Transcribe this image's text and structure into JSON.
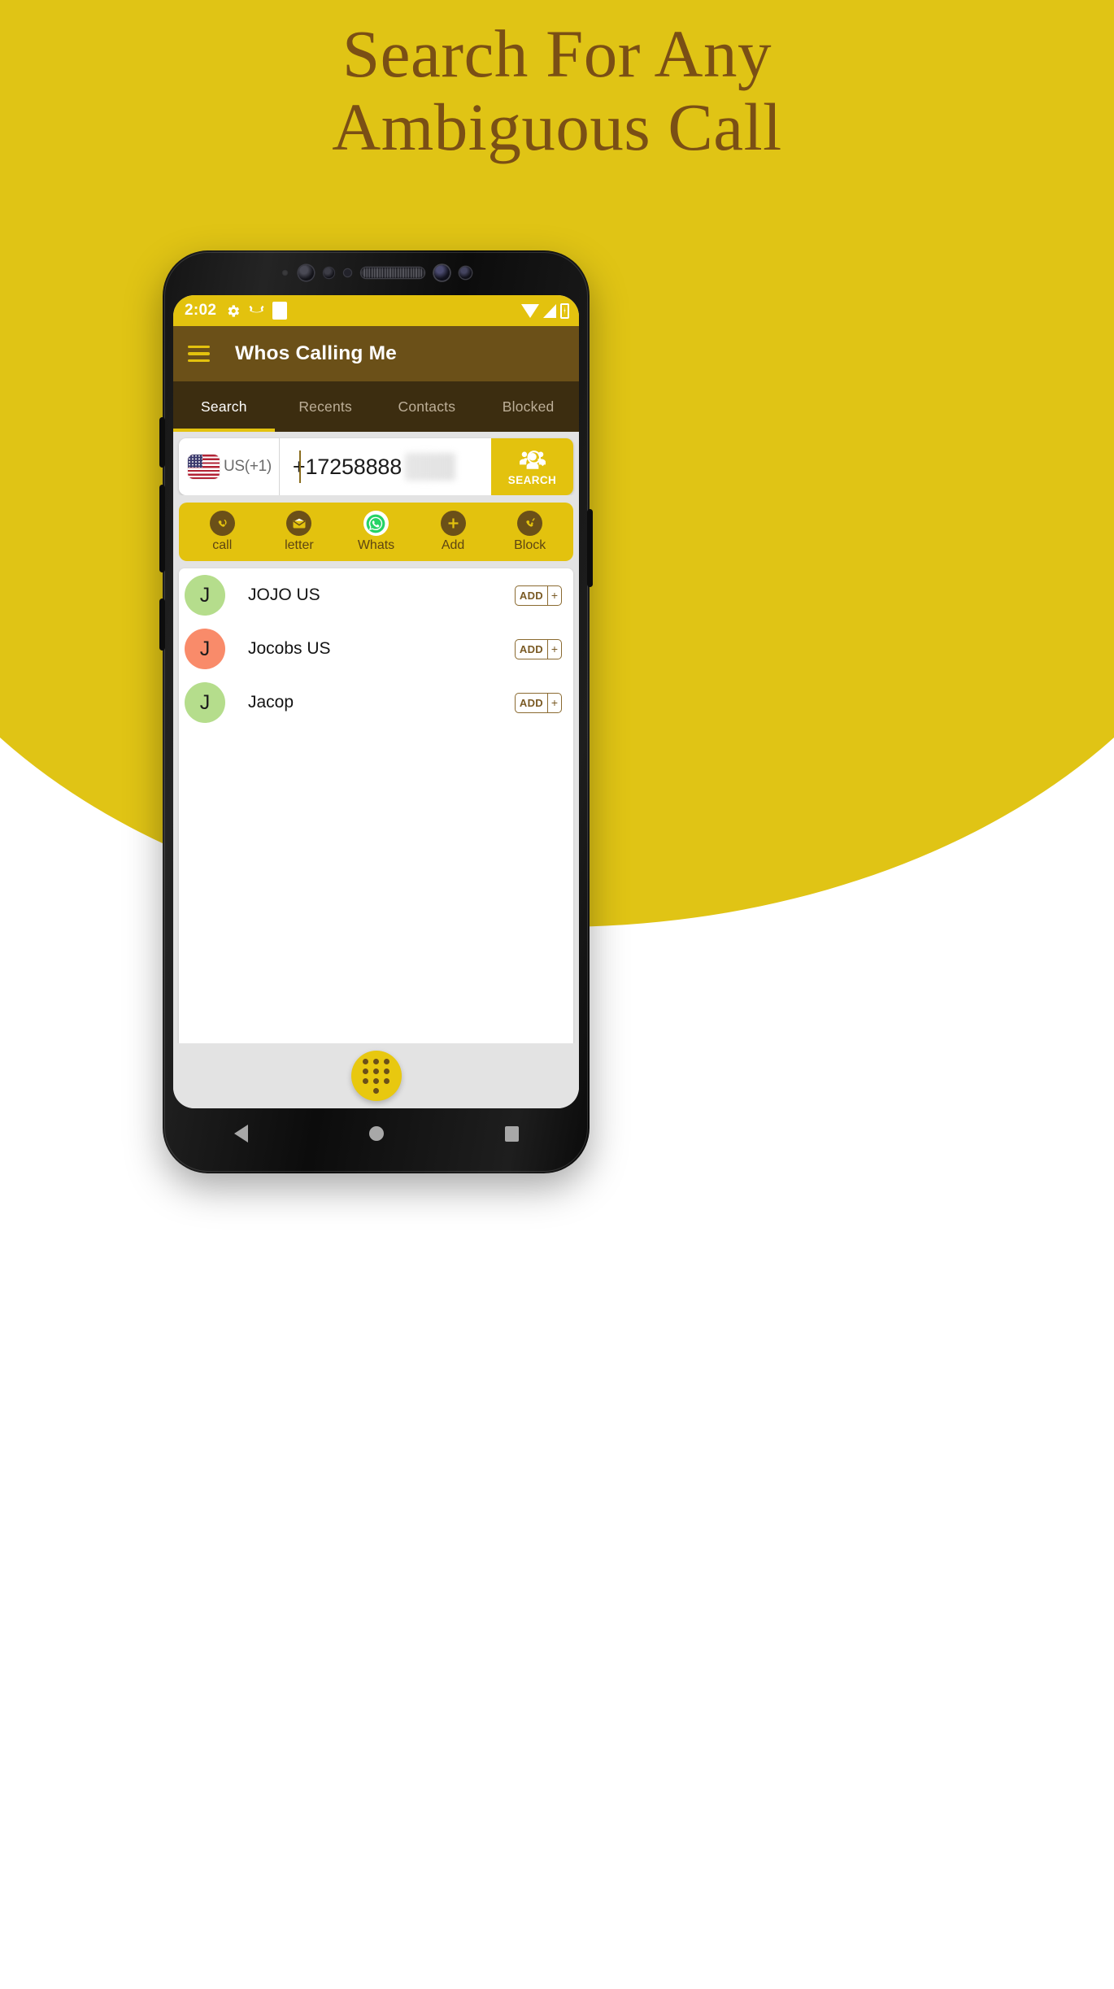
{
  "hero": {
    "headline_line1": "Search For Any",
    "headline_line2": "Ambiguous Call",
    "bg_color": "#E0C415",
    "text_color": "#7A4F15"
  },
  "phone": {
    "statusbar": {
      "time": "2:02",
      "left_icons": [
        "gear-icon",
        "missed-call-icon",
        "white-square-icon"
      ],
      "right_icons": [
        "wifi-icon",
        "signal-icon",
        "battery-icon"
      ],
      "bg_color": "#E3C20E"
    },
    "appbar": {
      "menu_icon": "hamburger-icon",
      "title": "Whos Calling Me",
      "bg_color": "#6B5018"
    },
    "tabs": {
      "bg_color": "#3C2D10",
      "active_index": 0,
      "items": [
        {
          "label": "Search"
        },
        {
          "label": "Recents"
        },
        {
          "label": "Contacts"
        },
        {
          "label": "Blocked"
        }
      ]
    },
    "search": {
      "country_flag": "us-flag-icon",
      "country_label": "US(+1)",
      "phone_number": "+17258888",
      "phone_number_masked_suffix": "000",
      "button_label": "SEARCH",
      "button_icon": "people-search-icon",
      "button_color": "#E3C20E"
    },
    "actions": {
      "bg_color": "#E3C20E",
      "items": [
        {
          "label": "call",
          "icon": "call-bubble-icon"
        },
        {
          "label": "letter",
          "icon": "envelope-icon"
        },
        {
          "label": "Whats",
          "icon": "whatsapp-icon"
        },
        {
          "label": "Add",
          "icon": "plus-icon"
        },
        {
          "label": "Block",
          "icon": "call-block-icon"
        }
      ]
    },
    "contacts": {
      "add_button_label": "ADD",
      "add_button_plus": "+",
      "items": [
        {
          "initial": "J",
          "name": "JOJO US",
          "avatar_color": "#B5DD8C"
        },
        {
          "initial": "J",
          "name": "Jocobs US",
          "avatar_color": "#F98B6A"
        },
        {
          "initial": "J",
          "name": "Jacop",
          "avatar_color": "#B5DD8C"
        }
      ]
    },
    "fab": {
      "icon": "dialpad-icon",
      "color": "#E8C80F"
    },
    "navbar": {
      "back_icon": "back-triangle-icon",
      "home_icon": "home-circle-icon",
      "recents_icon": "recents-square-icon"
    }
  }
}
